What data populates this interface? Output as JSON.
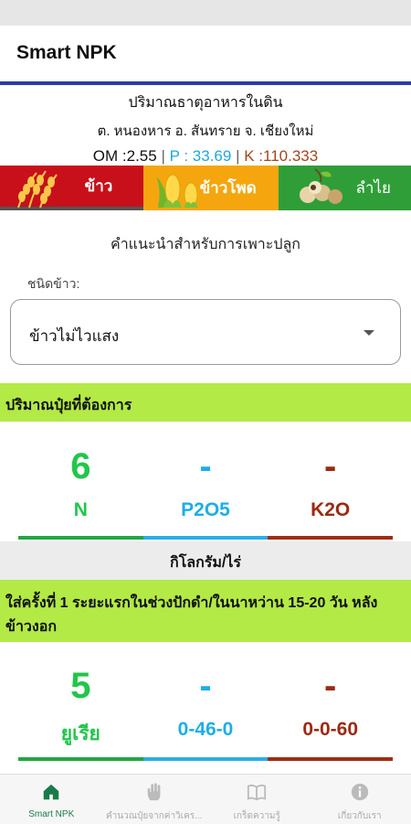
{
  "app": {
    "title": "Smart NPK"
  },
  "soil": {
    "heading": "ปริมาณธาตุอาหารในดิน",
    "location": "ต. หนองหาร อ. สันทราย จ. เชียงใหม่",
    "om": "OM :2.55",
    "p": "P : 33.69",
    "k": "K :110.333",
    "separator": "|"
  },
  "crops": [
    {
      "label": "ข้าว",
      "icon": "rice-icon",
      "color": "#c8101a",
      "selected": true
    },
    {
      "label": "ข้าวโพด",
      "icon": "corn-icon",
      "color": "#f5a60e",
      "selected": false
    },
    {
      "label": "ลำไย",
      "icon": "longan-icon",
      "color": "#2f9e38",
      "selected": false
    }
  ],
  "advice_title": "คำแนะนำสำหรับการเพาะปลูก",
  "rice_type": {
    "label": "ชนิดข้าว:",
    "value": "ข้าวไม่ไวแสง"
  },
  "fertilizer_needed": {
    "title": "ปริมาณปุ๋ยที่ต้องการ",
    "items": [
      {
        "value": "6",
        "label": "N",
        "color": "#21c64a"
      },
      {
        "value": "-",
        "label": "P2O5",
        "color": "#1eaee6"
      },
      {
        "value": "-",
        "label": "K2O",
        "color": "#9b2a10"
      }
    ],
    "unit": "กิโลกรัม/ไร่"
  },
  "application": {
    "title": "ใส่ครั้งที่ 1  ระยะแรกในช่วงปักดำ/ในนาหว่าน 15-20 วัน หลังข้าวงอก",
    "items": [
      {
        "value": "5",
        "label": "ยูเรีย",
        "color": "#21c64a"
      },
      {
        "value": "-",
        "label": "0-46-0",
        "color": "#1eaee6"
      },
      {
        "value": "-",
        "label": "0-0-60",
        "color": "#9b2a10"
      }
    ]
  },
  "nav": [
    {
      "label": "Smart NPK",
      "icon": "home-icon",
      "active": true
    },
    {
      "label": "คำนวณปุ๋ยจากค่าวิเคร...",
      "icon": "hand-icon",
      "active": false
    },
    {
      "label": "เกร็ดความรู้",
      "icon": "book-icon",
      "active": false
    },
    {
      "label": "เกี่ยวกับเรา",
      "icon": "info-icon",
      "active": false
    }
  ]
}
